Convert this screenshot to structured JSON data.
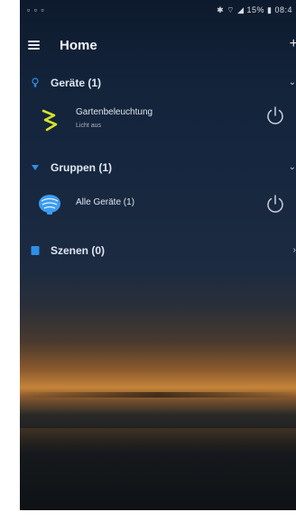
{
  "status": {
    "left": "▫ ▫ ▫",
    "right": "✱ ⌔ ◢ 15% ▮ 08:4"
  },
  "header": {
    "title": "Home"
  },
  "sections": {
    "geraete": {
      "label": "Geräte (1)"
    },
    "gruppen": {
      "label": "Gruppen (1)"
    },
    "szenen": {
      "label": "Szenen (0)"
    }
  },
  "devices": [
    {
      "name": "Gartenbeleuchtung",
      "status": "Licht aus"
    }
  ],
  "groups": [
    {
      "name": "Alle Geräte (1)"
    }
  ],
  "colors": {
    "accent_blue": "#2e8fe6",
    "device_icon": "#d6e22a",
    "power_icon": "#c9cfd8"
  }
}
